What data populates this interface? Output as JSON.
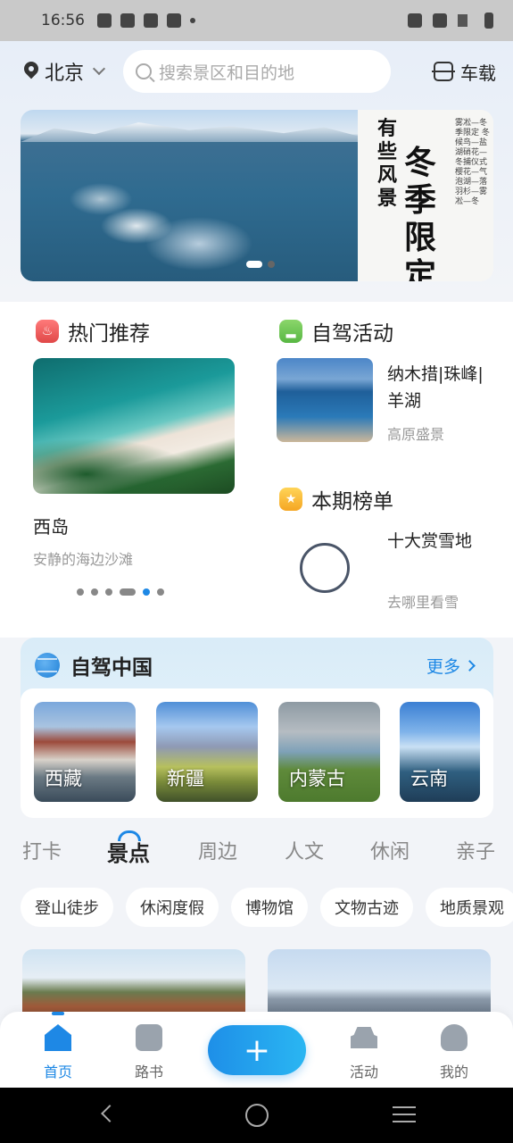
{
  "status_bar": {
    "time": "16:56"
  },
  "topbar": {
    "city": "北京",
    "search_placeholder": "搜索景区和目的地",
    "car_mode": "车载"
  },
  "banner": {
    "title_small": "有些风景",
    "title_big": "冬季限定",
    "poem": "雾凇—冬季限定 冬候鸟—盐湖硝花—冬捕仪式 樱花—气泡湖—落羽杉—雾凇—冬",
    "page_count": 2,
    "current_page": 1
  },
  "recommend": {
    "hot_label": "热门推荐",
    "hot_title": "西岛",
    "hot_subtitle": "安静的海边沙滩",
    "pager_count": 6,
    "pager_active": 5,
    "drive_label": "自驾活动",
    "drive_title": "纳木措|珠峰|羊湖",
    "drive_subtitle": "高原盛景",
    "rank_label": "本期榜单",
    "rank_title": "十大赏雪地",
    "rank_subtitle": "去哪里看雪"
  },
  "china": {
    "title": "自驾中国",
    "more": "更多",
    "regions": [
      "西藏",
      "新疆",
      "内蒙古",
      "云南"
    ]
  },
  "tabs": [
    "打卡",
    "景点",
    "周边",
    "人文",
    "休闲",
    "亲子"
  ],
  "active_tab": "景点",
  "chips": [
    "登山徒步",
    "休闲度假",
    "博物馆",
    "文物古迹",
    "地质景观"
  ],
  "bottom_nav": {
    "home": "首页",
    "roadbook": "路书",
    "plus": "+",
    "activity": "活动",
    "me": "我的",
    "accent": "#1e88e5"
  }
}
